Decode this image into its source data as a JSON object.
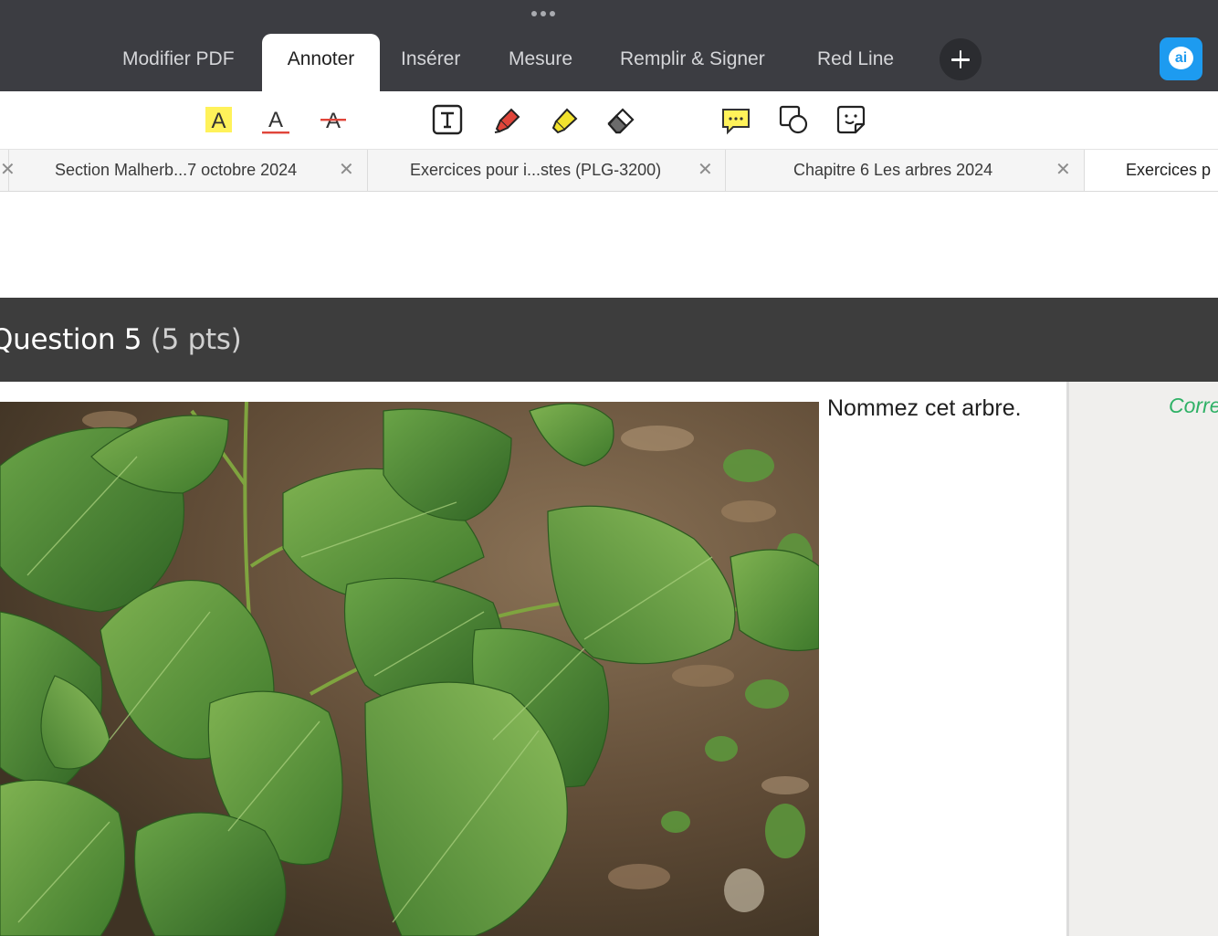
{
  "app": {
    "menu_tabs": [
      {
        "label": "Modifier PDF",
        "active": false
      },
      {
        "label": "Annoter",
        "active": true
      },
      {
        "label": "Insérer",
        "active": false
      },
      {
        "label": "Mesure",
        "active": false
      },
      {
        "label": "Remplir & Signer",
        "active": false
      },
      {
        "label": "Red Line",
        "active": false
      }
    ],
    "ai_button_label": "ai",
    "accent_color": "#1d9bf0"
  },
  "toolbar": {
    "tools": [
      "highlight-text-icon",
      "underline-text-icon",
      "strikethrough-text-icon",
      "text-box-icon",
      "pen-icon",
      "highlighter-icon",
      "eraser-icon",
      "comment-icon",
      "shapes-icon",
      "sticker-icon"
    ]
  },
  "doc_tabs": [
    {
      "label": "Section Malherb...7 octobre 2024",
      "active": false
    },
    {
      "label": "Exercices pour i...stes (PLG-3200)",
      "active": false
    },
    {
      "label": "Chapitre 6 Les arbres  2024",
      "active": false
    },
    {
      "label": "Exercices p",
      "active": true
    }
  ],
  "document": {
    "question_number": "Question 5",
    "question_points": "(5 pts)",
    "question_text": "Nommez cet arbre.",
    "side_label": "Corre",
    "side_label_color": "#2fb166"
  }
}
